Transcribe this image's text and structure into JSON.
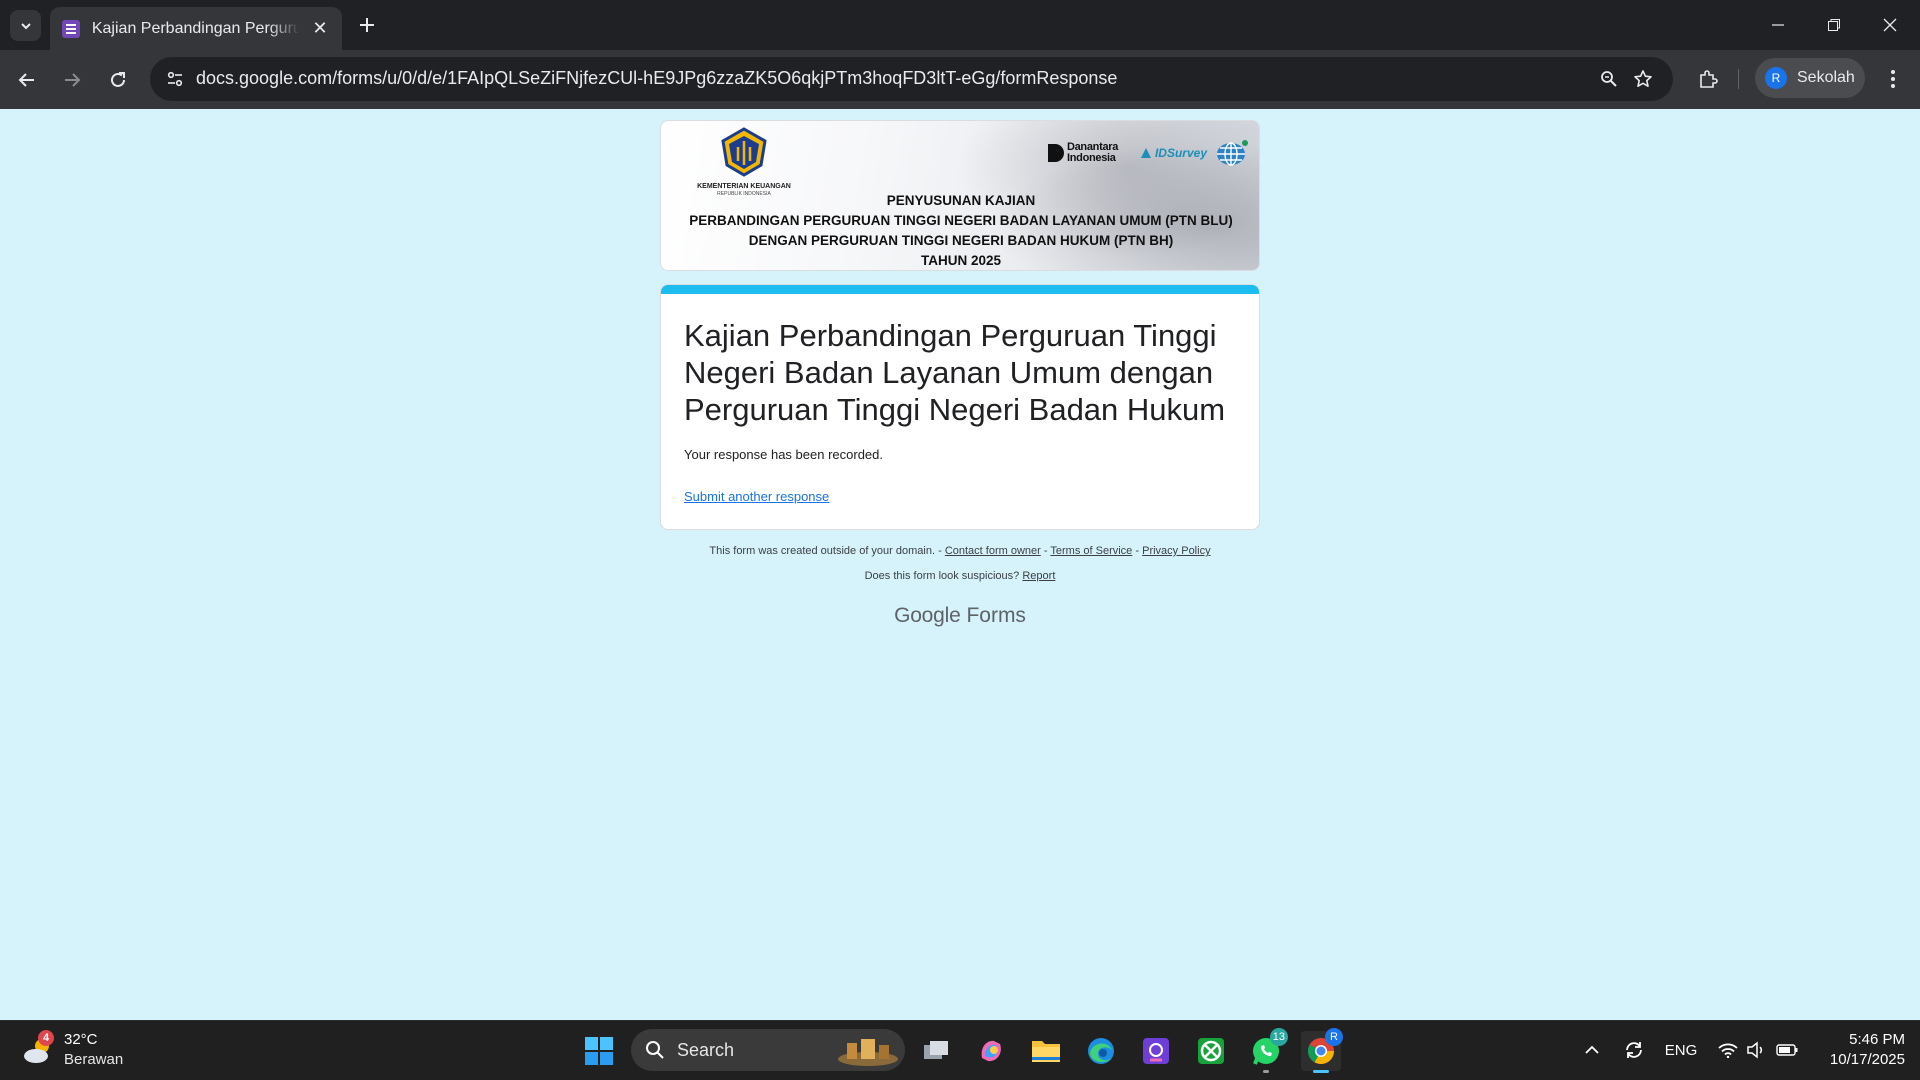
{
  "browser": {
    "tab": {
      "title": "Kajian Perbandingan Perguruan Tinggi",
      "favicon": "google-forms-icon"
    },
    "url": "docs.google.com/forms/u/0/d/e/1FAIpQLSeZiFNjfezCUl-hE9JPg6zzaZK5O6qkjPTm3hoqFD3ltT-eGg/formResponse",
    "profile": {
      "initial": "R",
      "name": "Sekolah"
    }
  },
  "banner": {
    "org_name": "KEMENTERIAN KEUANGAN",
    "org_sub": "REPUBLIK INDONESIA",
    "partner1": "Danantara Indonesia",
    "partner2": "IDSurvey",
    "line1": "PENYUSUNAN KAJIAN",
    "line2": "PERBANDINGAN PERGURUAN TINGGI NEGERI BADAN LAYANAN UMUM (PTN BLU)",
    "line3": "DENGAN PERGURUAN TINGGI NEGERI BADAN HUKUM (PTN BH)",
    "line4": "TAHUN 2025"
  },
  "form": {
    "title": "Kajian Perbandingan Perguruan Tinggi Negeri Badan Layanan Umum dengan Perguruan Tinggi Negeri Badan Hukum",
    "confirmation": "Your response has been recorded.",
    "submit_another": "Submit another response"
  },
  "footer": {
    "domain_note": "This form was created outside of your domain. -",
    "contact": "Contact form owner",
    "sep": "-",
    "terms": "Terms of Service",
    "privacy": "Privacy Policy",
    "suspicious": "Does this form look suspicious?",
    "report": "Report",
    "brand_google": "Google",
    "brand_forms": "Forms"
  },
  "taskbar": {
    "weather": {
      "temp": "32°C",
      "condition": "Berawan",
      "badge": "4"
    },
    "search_label": "Search",
    "whatsapp_badge": "13",
    "chrome_profile": "R",
    "language": "ENG",
    "time": "5:46 PM",
    "date": "10/17/2025"
  },
  "colors": {
    "accent": "#1dbdef",
    "page_bg": "#d6f3fc",
    "link": "#1a73e8"
  }
}
